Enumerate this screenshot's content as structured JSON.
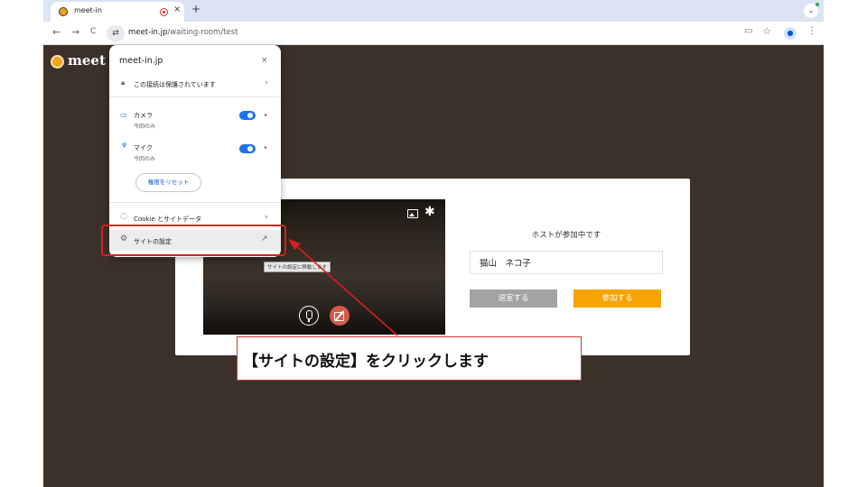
{
  "browser": {
    "tab": {
      "title": "meet-in"
    },
    "tab_close": "×",
    "new_tab": "+",
    "tab_menu": "⌄",
    "nav": {
      "back": "←",
      "forward": "→",
      "reload": "C"
    },
    "site_info_icon": "⇄",
    "url_host": "meet-in.jp",
    "url_path": "/waiting-room/test",
    "right_icons": {
      "video": "▭",
      "star": "☆",
      "profile": "●",
      "menu": "⋮"
    }
  },
  "page": {
    "logo_text": "meet i"
  },
  "popup": {
    "title": "meet-in.jp",
    "close": "×",
    "connection": "この接続は保護されています",
    "camera": {
      "label": "カメラ",
      "sub": "今回のみ"
    },
    "mic": {
      "label": "マイク",
      "sub": "今回のみ"
    },
    "reset_button": "権限をリセット",
    "cookies": "Cookie とサイトデータ",
    "site_settings": "サイトの設定",
    "chevron": "›",
    "triangle": "▸",
    "external": "↗"
  },
  "waiting_room": {
    "tooltip": "サイトの設定に移動します",
    "host_message": "ホストが参加中です",
    "name_value": "猫山　ネコ子",
    "leave_button": "退室する",
    "join_button": "参加する"
  },
  "annotation": {
    "text": "【サイトの設定】をクリックします"
  },
  "colors": {
    "page_background": "#3b302a",
    "accent_orange": "#f7a300",
    "toggle_blue": "#1a73e8",
    "annotation_red": "#d81f1f"
  }
}
